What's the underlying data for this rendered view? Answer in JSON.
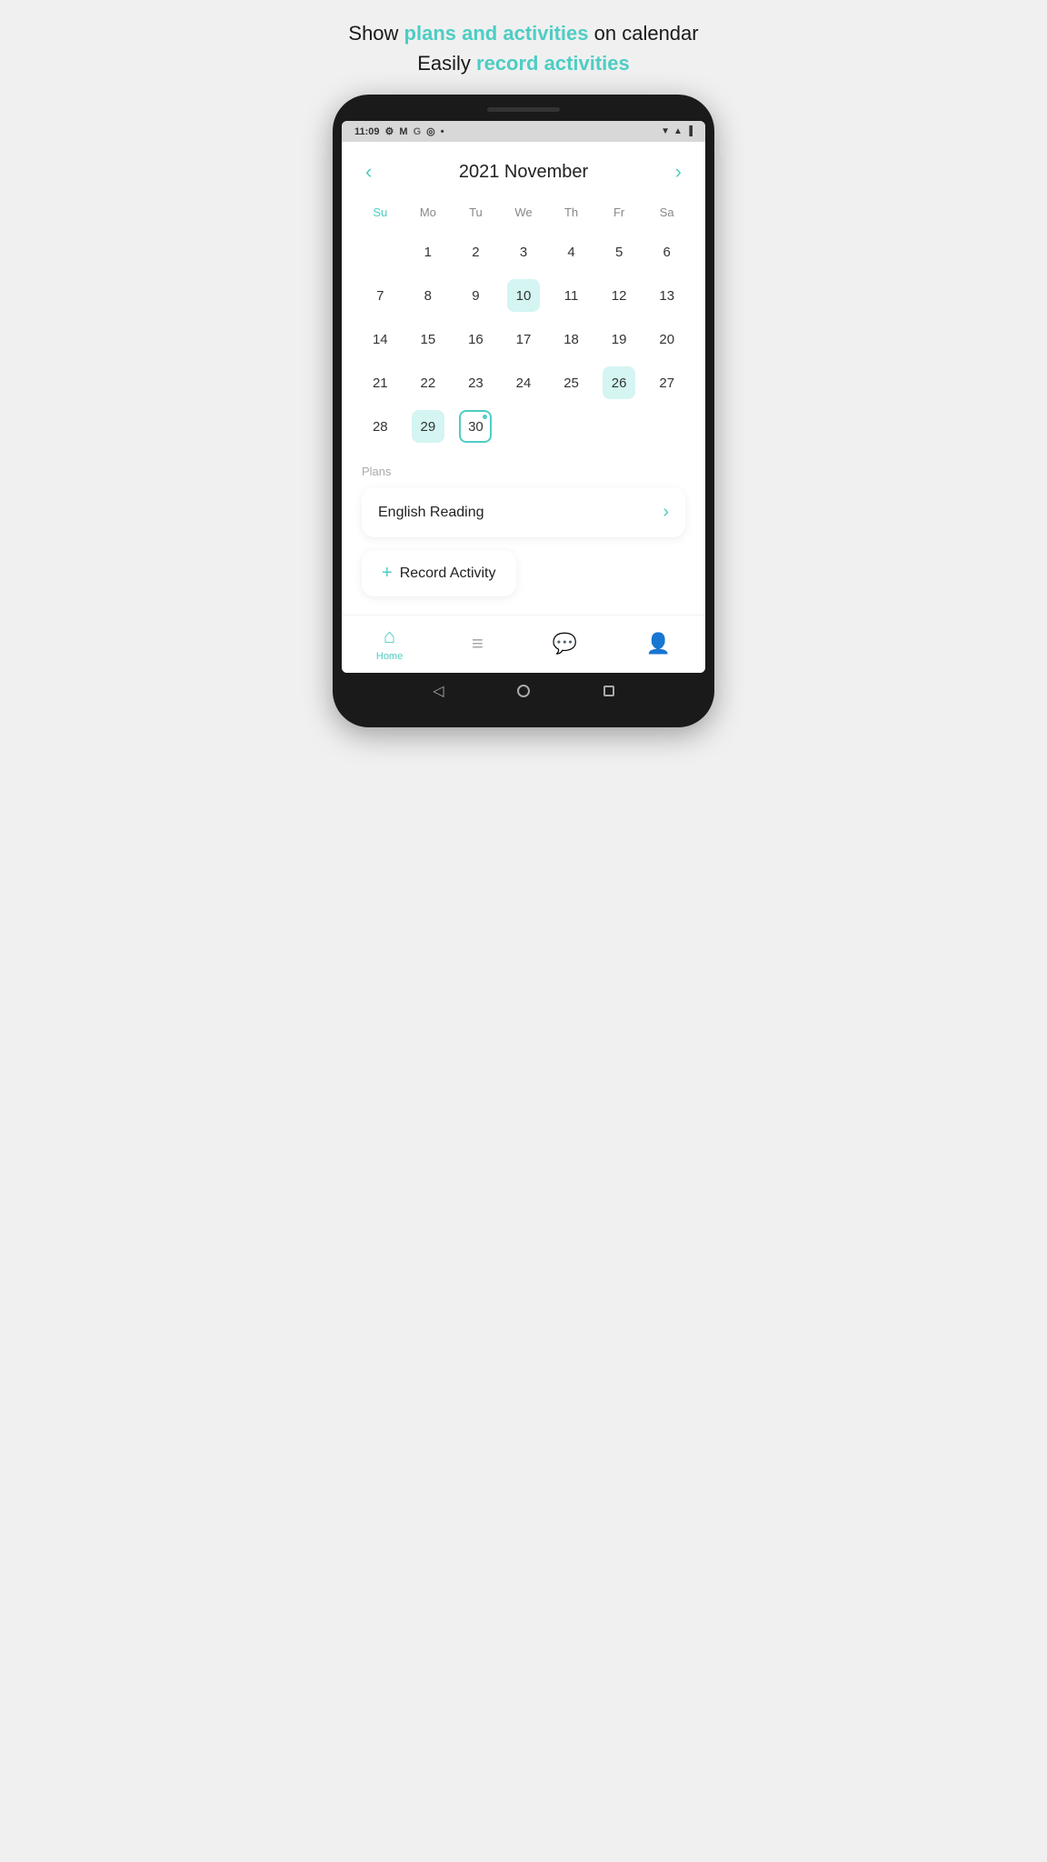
{
  "headline": {
    "line1_pre": "Show ",
    "line1_accent": "plans and activities",
    "line1_post": " on calendar",
    "line2_pre": "Easily ",
    "line2_accent": "record activities"
  },
  "status_bar": {
    "time": "11:09",
    "icons": [
      "⚙",
      "M",
      "G",
      "◎",
      "•"
    ]
  },
  "calendar": {
    "title": "2021 November",
    "prev_label": "‹",
    "next_label": "›",
    "weekdays": [
      "Su",
      "Mo",
      "Tu",
      "We",
      "Th",
      "Fr",
      "Sa"
    ],
    "days": [
      {
        "num": "",
        "type": "empty"
      },
      {
        "num": "1",
        "type": "normal"
      },
      {
        "num": "2",
        "type": "normal"
      },
      {
        "num": "3",
        "type": "normal"
      },
      {
        "num": "4",
        "type": "normal"
      },
      {
        "num": "5",
        "type": "normal"
      },
      {
        "num": "6",
        "type": "normal"
      },
      {
        "num": "7",
        "type": "normal"
      },
      {
        "num": "8",
        "type": "normal"
      },
      {
        "num": "9",
        "type": "normal"
      },
      {
        "num": "10",
        "type": "highlighted"
      },
      {
        "num": "11",
        "type": "normal"
      },
      {
        "num": "12",
        "type": "normal"
      },
      {
        "num": "13",
        "type": "normal"
      },
      {
        "num": "14",
        "type": "normal"
      },
      {
        "num": "15",
        "type": "normal"
      },
      {
        "num": "16",
        "type": "normal"
      },
      {
        "num": "17",
        "type": "normal"
      },
      {
        "num": "18",
        "type": "normal"
      },
      {
        "num": "19",
        "type": "normal"
      },
      {
        "num": "20",
        "type": "normal"
      },
      {
        "num": "21",
        "type": "normal"
      },
      {
        "num": "22",
        "type": "normal"
      },
      {
        "num": "23",
        "type": "normal"
      },
      {
        "num": "24",
        "type": "normal"
      },
      {
        "num": "25",
        "type": "normal"
      },
      {
        "num": "26",
        "type": "highlighted"
      },
      {
        "num": "27",
        "type": "normal"
      },
      {
        "num": "28",
        "type": "normal"
      },
      {
        "num": "29",
        "type": "highlighted"
      },
      {
        "num": "30",
        "type": "outlined-dot"
      },
      {
        "num": "",
        "type": "empty"
      },
      {
        "num": "",
        "type": "empty"
      },
      {
        "num": "",
        "type": "empty"
      },
      {
        "num": "",
        "type": "empty"
      }
    ]
  },
  "plans": {
    "label": "Plans",
    "items": [
      {
        "name": "English Reading"
      }
    ]
  },
  "record_btn": {
    "plus": "+",
    "label": "Record Activity"
  },
  "bottom_nav": {
    "items": [
      {
        "icon": "🏠",
        "label": "Home",
        "active": true
      },
      {
        "icon": "≡",
        "label": "",
        "active": false
      },
      {
        "icon": "💬",
        "label": "",
        "active": false
      },
      {
        "icon": "👤",
        "label": "",
        "active": false
      }
    ]
  }
}
